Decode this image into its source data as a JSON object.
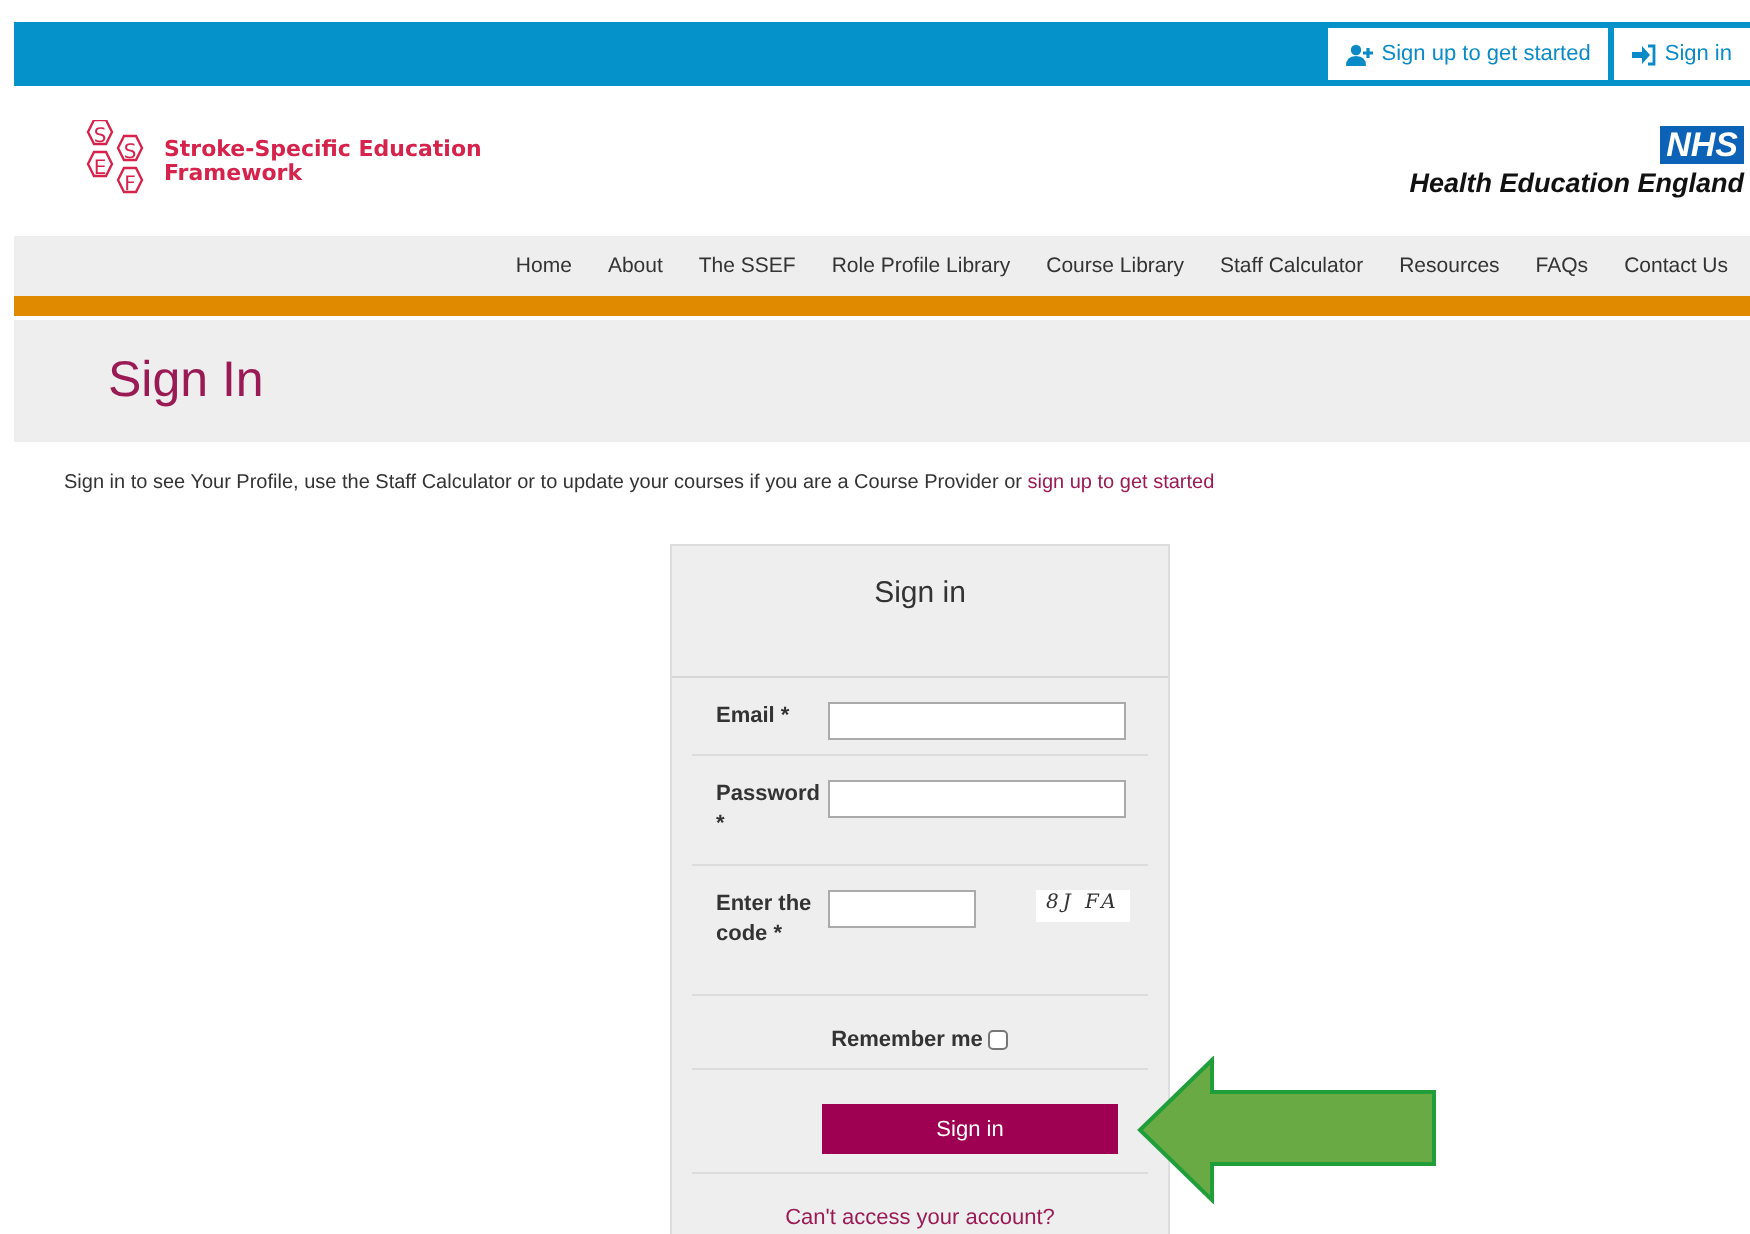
{
  "top_links": [
    {
      "label": "Sign up to get started",
      "kind": "user-plus"
    },
    {
      "label": "Sign in",
      "kind": "sign-in"
    }
  ],
  "logo": {
    "letters": [
      "S",
      "S",
      "E",
      "F"
    ],
    "name": "Stroke-Specific Education Framework"
  },
  "partner": {
    "badge": "NHS",
    "name": "Health Education England"
  },
  "nav": [
    "Home",
    "About",
    "The SSEF",
    "Role Profile Library",
    "Course Library",
    "Staff Calculator",
    "Resources",
    "FAQs",
    "Contact Us"
  ],
  "page_title": "Sign In",
  "intro": {
    "text": "Sign in to see Your Profile, use the Staff Calculator or to update your courses if you are a Course Provider or ",
    "link": "sign up to get started"
  },
  "card": {
    "title": "Sign in",
    "fields": [
      {
        "label": "Email *",
        "kind": "email"
      },
      {
        "label": "Password *",
        "kind": "password"
      },
      {
        "label": "Enter the code *",
        "kind": "captcha",
        "captcha": "8J FA"
      }
    ],
    "remember": {
      "label": "Remember me",
      "checked": false
    },
    "button": "Sign in",
    "link": "Can't access your account?"
  }
}
